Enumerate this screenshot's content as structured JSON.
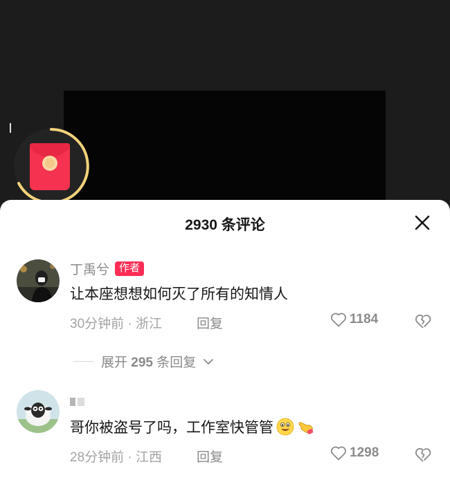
{
  "sheet": {
    "title": "2930 条评论"
  },
  "comments": [
    {
      "username": "丁禹兮",
      "badge": "作者",
      "text": "让本座想想如何灭了所有的知情人",
      "time": "30分钟前",
      "location": "浙江",
      "meta": "30分钟前 · 浙江",
      "reply_label": "回复",
      "likes": "1184",
      "expand": {
        "prefix": "展开",
        "count": "295",
        "suffix": "条回复"
      }
    },
    {
      "username": "",
      "text": "哥你被盗号了吗，工作室快管管",
      "emojis": [
        "grinning-face-emoji",
        "pointing-hand-emoji"
      ],
      "time": "28分钟前",
      "location": "江西",
      "meta": "28分钟前 · 江西",
      "reply_label": "回复",
      "likes": "1298"
    }
  ],
  "icons": {
    "close": "close-icon",
    "like": "heart-icon",
    "dislike": "broken-heart-icon",
    "expand": "chevron-down-icon",
    "red_packet": "red-envelope-icon"
  },
  "colors": {
    "badge": "#fe2c55",
    "progress_ring": "#f2d27a",
    "red_packet": "#f5324f",
    "sheet_bg": "#ffffff",
    "video_bg": "#1c1c1c"
  }
}
